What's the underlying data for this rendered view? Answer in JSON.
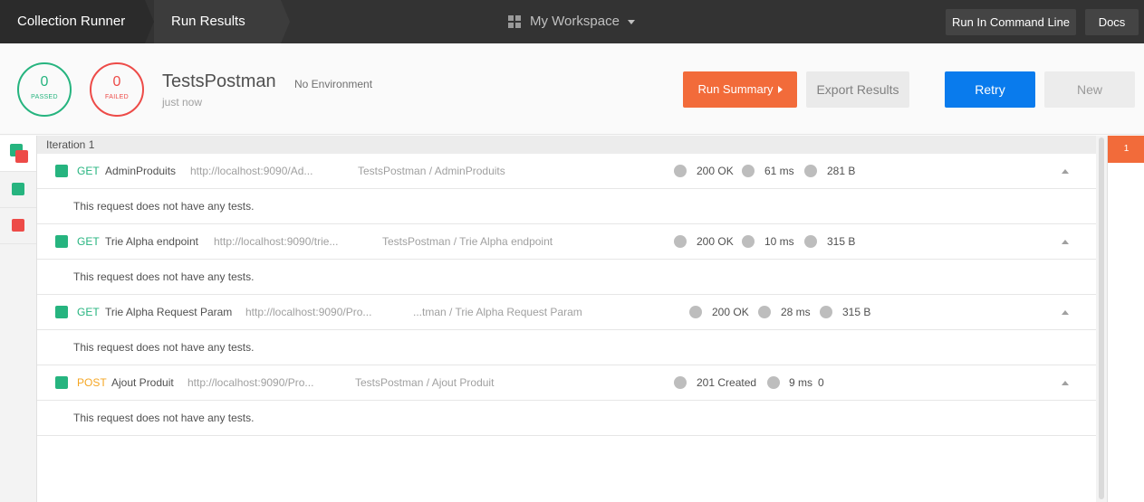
{
  "topbar": {
    "crumb_1": "Collection Runner",
    "crumb_2": "Run Results",
    "workspace": "My Workspace",
    "cmd_button": "Run In Command Line",
    "docs_button": "Docs"
  },
  "header": {
    "passed_count": "0",
    "passed_label": "PASSED",
    "failed_count": "0",
    "failed_label": "FAILED",
    "collection_name": "TestsPostman",
    "environment": "No Environment",
    "time": "just now",
    "run_summary": "Run Summary",
    "export_results": "Export Results",
    "retry": "Retry",
    "new": "New"
  },
  "iteration_label": "Iteration 1",
  "right_panel": {
    "tab": "1"
  },
  "colors": {
    "pass": "#26b47f",
    "fail": "#ed4b48",
    "accent": "#f26b3a",
    "primary": "#097bed",
    "post": "#f5a623"
  },
  "requests": [
    {
      "method": "GET",
      "name": "AdminProduits",
      "url": "http://localhost:9090/Ad...",
      "path": "TestsPostman / AdminProduits",
      "status": "200 OK",
      "time": "61 ms",
      "size": "281 B",
      "message": "This request does not have any tests."
    },
    {
      "method": "GET",
      "name": "Trie Alpha endpoint",
      "url": "http://localhost:9090/trie...",
      "path": "TestsPostman / Trie Alpha endpoint",
      "status": "200 OK",
      "time": "10 ms",
      "size": "315 B",
      "message": "This request does not have any tests."
    },
    {
      "method": "GET",
      "name": "Trie Alpha Request Param",
      "url": "http://localhost:9090/Pro...",
      "path": "...tman / Trie Alpha Request Param",
      "status": "200 OK",
      "time": "28 ms",
      "size": "315 B",
      "message": "This request does not have any tests."
    },
    {
      "method": "POST",
      "name": "Ajout Produit",
      "url": "http://localhost:9090/Pro...",
      "path": "TestsPostman / Ajout Produit",
      "status": "201 Created",
      "time": "9 ms",
      "size": "0",
      "message": "This request does not have any tests."
    }
  ]
}
